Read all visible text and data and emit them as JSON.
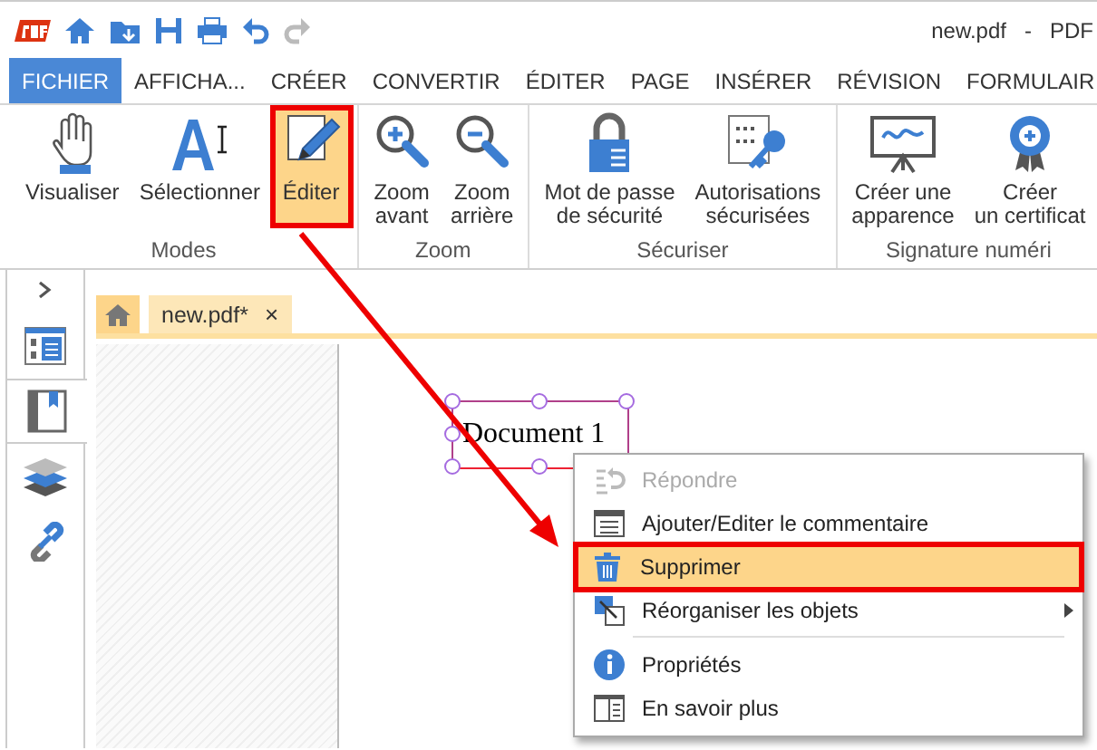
{
  "title_bar": {
    "title": "new.pdf   -   PDF"
  },
  "menu_tabs": [
    {
      "label": "FICHIER",
      "selected": true
    },
    {
      "label": "AFFICHA...",
      "selected": false
    },
    {
      "label": "CRÉER",
      "selected": false
    },
    {
      "label": "CONVERTIR",
      "selected": false
    },
    {
      "label": "ÉDITER",
      "selected": false
    },
    {
      "label": "PAGE",
      "selected": false
    },
    {
      "label": "INSÉRER",
      "selected": false
    },
    {
      "label": "RÉVISION",
      "selected": false
    },
    {
      "label": "FORMULAIR",
      "selected": false
    }
  ],
  "ribbon": {
    "groups": [
      {
        "label": "Modes",
        "buttons": [
          {
            "label": "Visualiser",
            "kind": "hand",
            "selected": false,
            "callout": false
          },
          {
            "label": "Sélectionner",
            "kind": "select",
            "selected": false,
            "callout": false
          },
          {
            "label": "Éditer",
            "kind": "edit",
            "selected": true,
            "callout": true
          }
        ]
      },
      {
        "label": "Zoom",
        "buttons": [
          {
            "label": "Zoom\navant",
            "kind": "zoom-in",
            "selected": false,
            "callout": false
          },
          {
            "label": "Zoom\narrière",
            "kind": "zoom-out",
            "selected": false,
            "callout": false
          }
        ]
      },
      {
        "label": "Sécuriser",
        "buttons": [
          {
            "label": "Mot de passe\nde sécurité",
            "kind": "lock",
            "selected": false,
            "callout": false
          },
          {
            "label": "Autorisations\nsécurisées",
            "kind": "key",
            "selected": false,
            "callout": false
          }
        ]
      },
      {
        "label": "Signature numéri",
        "buttons": [
          {
            "label": "Créer une\napparence",
            "kind": "sign",
            "selected": false,
            "callout": false
          },
          {
            "label": "Créer\nun certificat",
            "kind": "certificate",
            "selected": false,
            "callout": false
          }
        ]
      }
    ]
  },
  "sidebar": {
    "items": [
      {
        "kind": "thumbnails",
        "selected": false
      },
      {
        "kind": "bookmarks",
        "selected": true
      },
      {
        "kind": "layers",
        "selected": false
      },
      {
        "kind": "links",
        "selected": false
      }
    ]
  },
  "document_tabs": [
    {
      "kind": "home",
      "selected": false
    },
    {
      "kind": "file",
      "label": "new.pdf*",
      "close": "×",
      "selected": true
    }
  ],
  "document": {
    "annotation": {
      "text": "Document 1",
      "selected": true
    }
  },
  "context_menu": {
    "items": [
      {
        "label": "Répondre",
        "kind": "reply",
        "disabled": true,
        "selected": false,
        "submenu": false,
        "separator_before": false,
        "callout": false
      },
      {
        "label": "Ajouter/Editer le commentaire",
        "kind": "comment",
        "disabled": false,
        "selected": false,
        "submenu": false,
        "separator_before": false,
        "callout": false
      },
      {
        "label": "Supprimer",
        "kind": "delete",
        "disabled": false,
        "selected": true,
        "submenu": false,
        "separator_before": false,
        "callout": true
      },
      {
        "label": "Réorganiser les objets",
        "kind": "arrange",
        "disabled": false,
        "selected": false,
        "submenu": true,
        "separator_before": false,
        "callout": false
      },
      {
        "label": "Propriétés",
        "kind": "info",
        "disabled": false,
        "selected": false,
        "submenu": false,
        "separator_before": true,
        "callout": false
      },
      {
        "label": "En savoir plus",
        "kind": "learn",
        "disabled": false,
        "selected": false,
        "submenu": false,
        "separator_before": false,
        "callout": false
      }
    ]
  },
  "callout_arrow": true
}
